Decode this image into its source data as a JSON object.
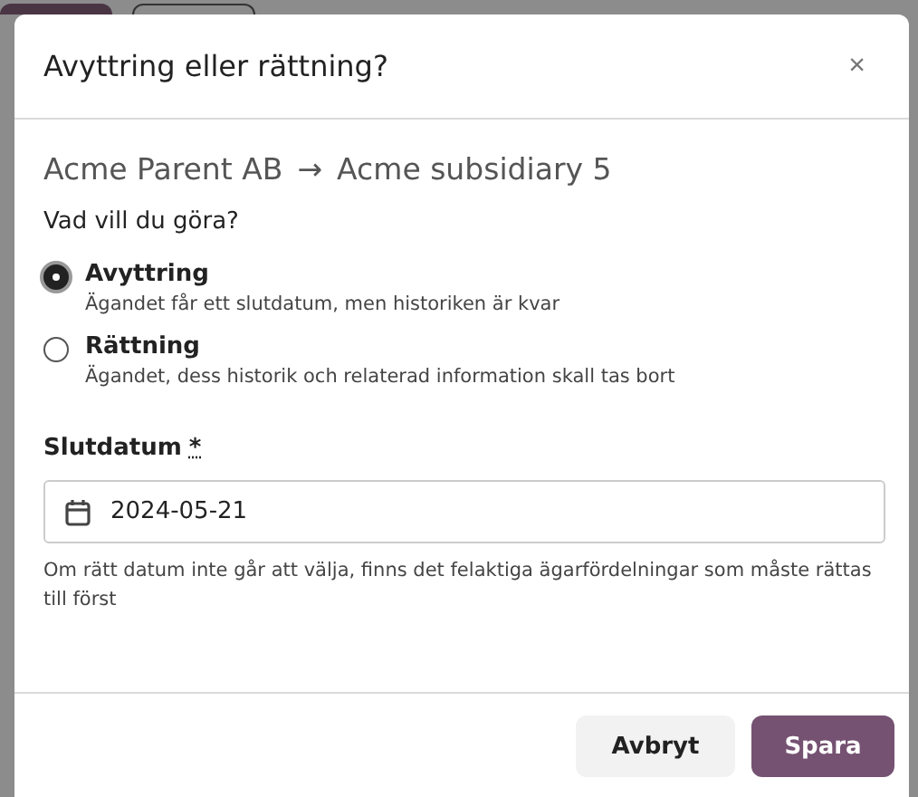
{
  "dialog": {
    "title": "Avyttring eller rättning?",
    "close": "×"
  },
  "relation": {
    "from": "Acme Parent AB",
    "arrow": "→",
    "to": "Acme subsidiary 5"
  },
  "question": "Vad vill du göra?",
  "options": [
    {
      "label": "Avyttring",
      "description": "Ägandet får ett slutdatum, men historiken är kvar",
      "selected": true
    },
    {
      "label": "Rättning",
      "description": "Ägandet, dess historik och relaterad information skall tas bort",
      "selected": false
    }
  ],
  "end_date": {
    "label": "Slutdatum",
    "required_mark": "*",
    "value": "2024-05-21",
    "help": "Om rätt datum inte går att välja, finns det felaktiga ägarfördelningar som måste rättas till först"
  },
  "buttons": [
    {
      "label": "Avbryt",
      "kind": "secondary"
    },
    {
      "label": "Spara",
      "kind": "primary"
    }
  ]
}
